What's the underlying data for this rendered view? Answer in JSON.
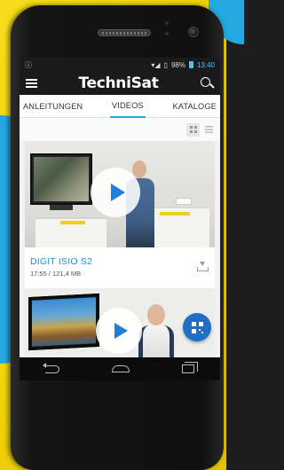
{
  "statusbar": {
    "battery": "98%",
    "time": "13:40"
  },
  "app": {
    "brand": "TechniSat"
  },
  "tabs": [
    {
      "label": "ANLEITUNGEN",
      "active": false
    },
    {
      "label": "VIDEOS",
      "active": true
    },
    {
      "label": "KATALOGE",
      "active": false
    }
  ],
  "videos": [
    {
      "title": "DIGIT ISIO S2",
      "meta": "17:55 / 121,4 MB"
    }
  ],
  "colors": {
    "accent": "#25a7e1",
    "title": "#1f8fd8",
    "fab": "#1f6fc9",
    "background_yellow": "#f2d40c"
  },
  "icons": {
    "menu": "hamburger-icon",
    "search": "search-icon",
    "grid": "grid-view-icon",
    "list": "list-view-icon",
    "play": "play-icon",
    "download": "download-icon",
    "qr": "qr-code-icon",
    "back": "back-icon",
    "home": "home-icon",
    "recent": "recent-apps-icon"
  }
}
